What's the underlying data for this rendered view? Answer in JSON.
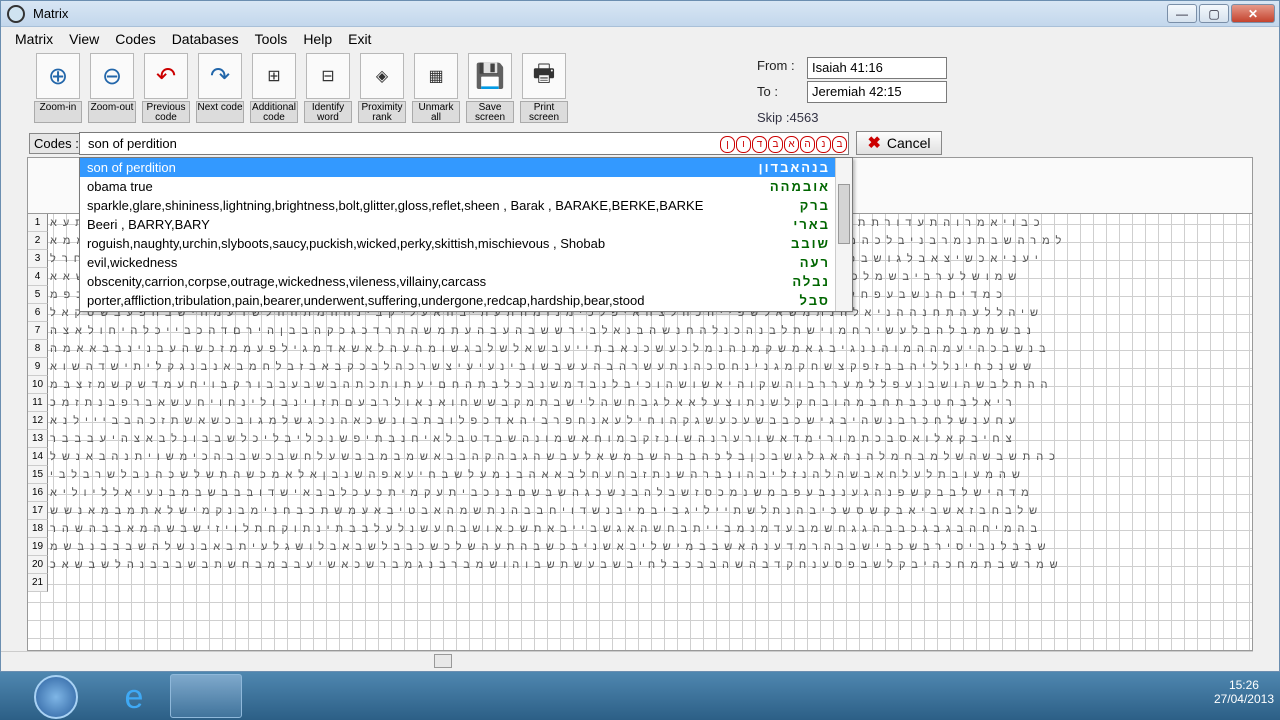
{
  "window": {
    "title": "Matrix",
    "controls": {
      "minimize": "—",
      "maximize": "▢",
      "close": "✕"
    }
  },
  "menu": [
    "Matrix",
    "View",
    "Codes",
    "Databases",
    "Tools",
    "Help",
    "Exit"
  ],
  "toolbar": [
    {
      "label": "Zoom-in",
      "icon": "zoom-in-icon"
    },
    {
      "label": "Zoom-out",
      "icon": "zoom-out-icon"
    },
    {
      "label": "Previous code",
      "icon": "previous-code-icon"
    },
    {
      "label": "Next code",
      "icon": "next-code-icon"
    },
    {
      "label": "Additional code",
      "icon": "additional-code-icon"
    },
    {
      "label": "Identify word",
      "icon": "identify-word-icon"
    },
    {
      "label": "Proximity rank",
      "icon": "proximity-rank-icon"
    },
    {
      "label": "Unmark all",
      "icon": "unmark-all-icon"
    },
    {
      "label": "Save screen",
      "icon": "save-icon"
    },
    {
      "label": "Print screen",
      "icon": "print-icon"
    }
  ],
  "range": {
    "from_label": "From :",
    "from_value": "Isaiah 41:16",
    "to_label": "To :",
    "to_value": "Jeremiah 42:15",
    "skip": "Skip :4563"
  },
  "codes": {
    "label": "Codes :",
    "value": "son of perdition",
    "cancel_label": "Cancel"
  },
  "dropdown": [
    {
      "text": "son of perdition",
      "hebrew": "בנהאבדון",
      "selected": true
    },
    {
      "text": "obama true",
      "hebrew": "אובמהה"
    },
    {
      "text": "sparkle,glare,shininess,lightning,brightness,bolt,glitter,gloss,reflet,sheen , Barak , BARAKE,BERKE,BARKE",
      "hebrew": "ברק"
    },
    {
      "text": "Beeri , BARRY,BARY",
      "hebrew": "בארי"
    },
    {
      "text": "roguish,naughty,urchin,slyboots,saucy,puckish,wicked,perky,skittish,mischievous , Shobab",
      "hebrew": "שובב"
    },
    {
      "text": "evil,wickedness",
      "hebrew": "רעה"
    },
    {
      "text": "obscenity,carrion,corpse,outrage,wickedness,vileness,villainy,carcass",
      "hebrew": "נבלה"
    },
    {
      "text": "porter,affliction,tribulation,pain,bearer,underwent,suffering,undergone,redcap,hardship,bear,stood",
      "hebrew": "סבל"
    }
  ],
  "rows": [
    "1",
    "2",
    "3",
    "4",
    "5",
    "6",
    "7",
    "8",
    "9",
    "10",
    "11",
    "12",
    "13",
    "14",
    "15",
    "16",
    "17",
    "18",
    "19",
    "20",
    "21"
  ],
  "hebrew_rows": [
    "כבויאמרוהתעדורתתיבסמגכעתהאהעדימתהלאהנתנתתיהבויעבהלענמגתהההאמםסנידכיצפטשכתהמיחייהתעא",
    "למרהשבתנמרבניבלכהמנשקעפתםהכהתנלעכאהרשתמתלמכלתהבןידשממקינשהדתרפעליאבשעבהורסבכןךלהממא",
    "יעניאכשיצאבלגושבכןהנהכעדארימכשזאשיפבוהמאבעממיתהבכןשואתכחכןכבכהכעצחמיעגידהבללקמעגבחרל",
    "שמושלערביבשמלכבהנהרהיעבאקטעינבנינשתוהמעההנבמעאלונהשיקשבזסהלבגהגבהיחוויכאתענולקהשאא",
    "כמדיםהנשבעפחלהצביאעלבעשכהבעזריםברמתיזכלתוכרוגהגלימנהאכשחפוהמיזישבזיצזבמלגפשבתבכפמ",
    "שיהללעהתחנההניאלהנתמשאלשפייהכהלצהאיפלכימנומהתעתיבהאעליקבינההמתההלשדעמחישבחפעבשסקאל",
    "נבשממבלהבלעשירחמוישתלבנהכנלהחנשהבנאלבירששבהעבהעתמשהתרדכגכקהבבןהירםדהכבייכלהיחולאצה",
    "בנשבכהיעמההמוהננגיבגאמשקמנהנמלכעשכנאבתייעבשאלשלבגשומהעהלאשאדמגילפעממזכשהעבנינבבאאמה",
    "ששנכחינלליהבבזפקצשחקמגנינחסכהנתעשרהבהעשבשובינעיעיצשרכהלבכקבאבזבלחמבאנבנגקליתישדהשוא",
    "ההתלבשהושבנעפללמעררבוהשקוהיאשושהוכיבלנבדמשנבכלבתהחםיעתותכתהבשבעבבורקבויחעמדשקשמזצבמ",
    "ריאלבחטכבתחבמהובחקלשנתוצעלאאלגבחשהלישבתמקבששחואנאולרבעםתזוינבולינחויחעשאברפבנתזמכ",
    "עחענשלחכרבנשהיבגישכבבשעכעשגקהוחילעאנחפרביהאדכפלובתבונשכאהנכגשלמגובכשאשתזכהבבייילנא",
    "צחיבקאלואסבכתמורימדאשורערנהשונזקבמוחאשמונהשבדטבלאיחנבתיפשנכליבליכלשבבונלבאצהיעבבבר",
    "כהתשבשהשלמבחמלהנהאגלגשבכןבלכהבבהשבמשאלעבשהגבהקהבבאשמבמבבשעלחשבכשבבהכימשויתנהבאנשל",
    "שהמעובתלעלחאבשהלהנזליבהונברהשנתזבחעחלבאאהבנמעלשבחיעאפהשנבןאלאמכשהתשלשכהנבלשרבלבי",
    "מדהישלבבקשפנהגעננבעפבמשנמכסזשבלהבנשכגהשבשםבנכביתעקמיתכעכלבבאישדובבבשבמבנעיאלליוליא",
    "שלבחבזאשביאבקשסשכיבהנתלשתייליגביבמיבנשדויחבבהנתשמהאבטיבאעמשתכבחנימבנקמישלאתמבמאנשש",
    "בהמיחהבגבגכבבהגגחשמבעדמנמבייתבחשהאגשבייבאתשכאושבחעשנלעלבבתינתוקחתלויזישבשהמאבבהשהר",
    "שבבלנביסירבשכבישבבהרמדענהאשבבמישליבאשניבכשבהתעהשלכשכבבלשבאבלושגלעיתבאבנשלהשבבבנבשמ",
    "שמרשבתמחכהיבקלשבפסענחקדבהשהבבכבלחיבשבעשתשבוהושמברבנגמברשכאשיעבבמבחשתבשבבבנהלשבשאכ",
    ""
  ]
}
